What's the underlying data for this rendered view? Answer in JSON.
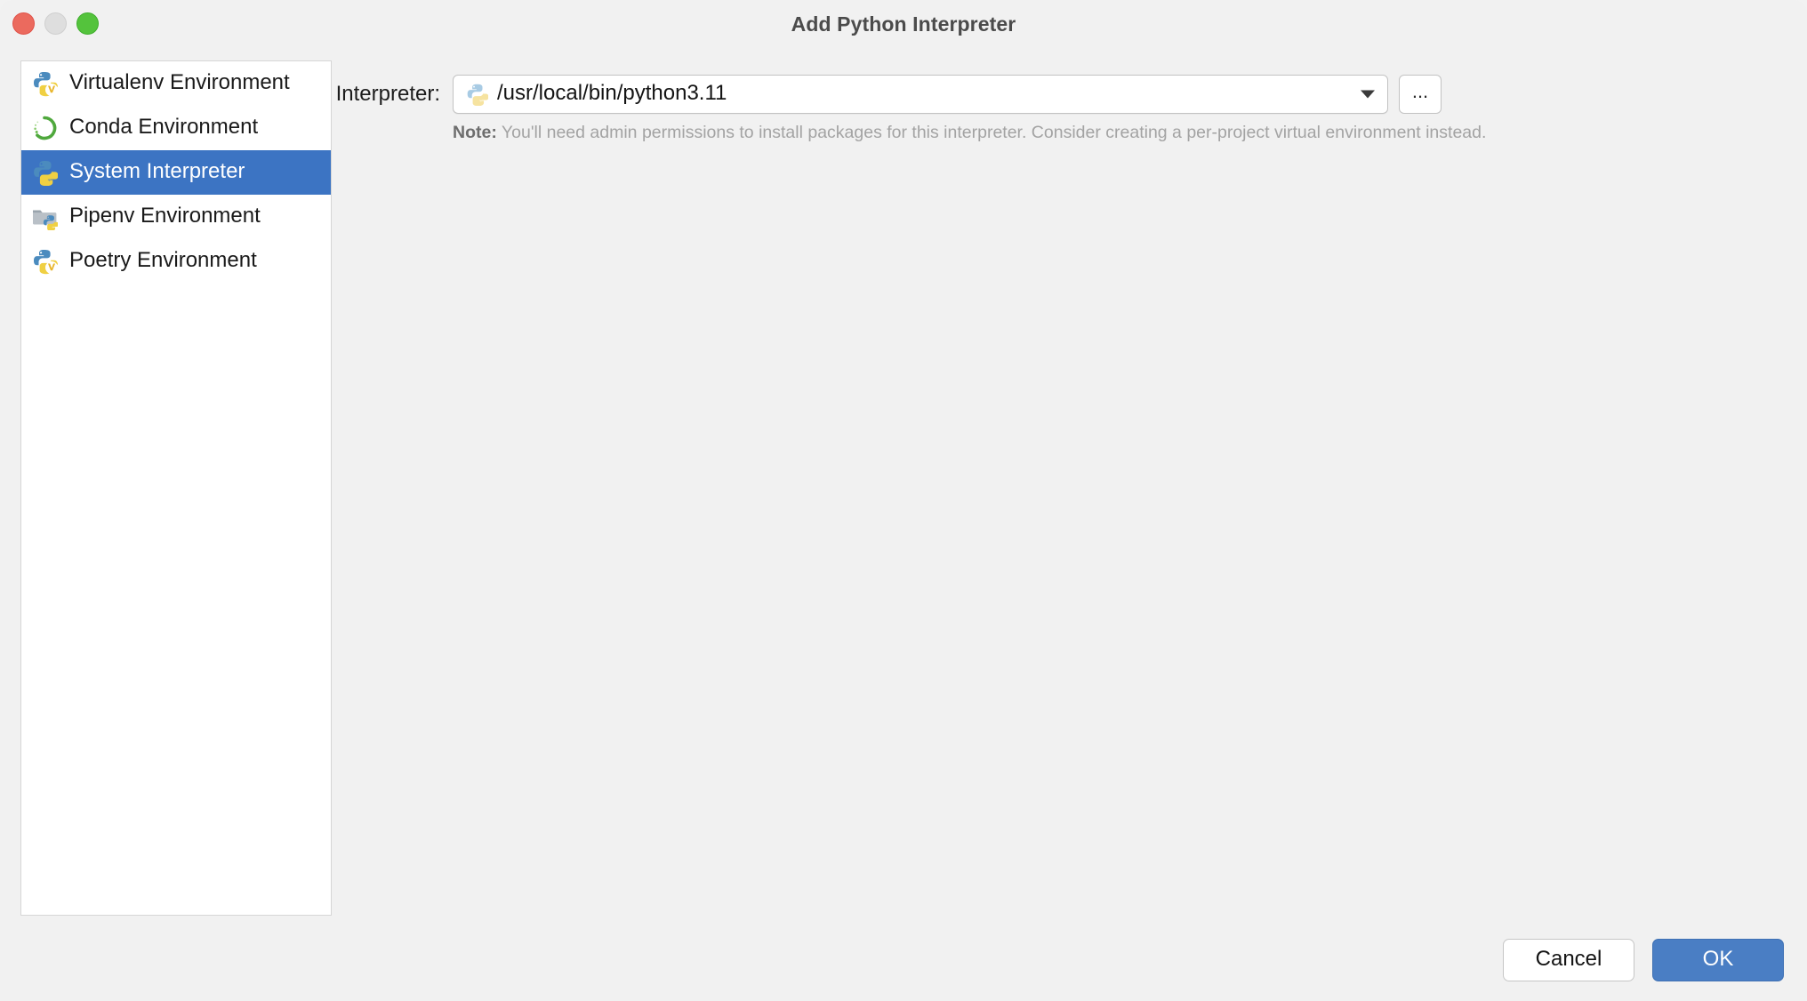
{
  "window": {
    "title": "Add Python Interpreter",
    "traffic_lights": {
      "close": "close-window",
      "minimize": "minimize-window",
      "zoom": "zoom-window",
      "close_color": "#eb6a5e",
      "minimize_color": "#dedede",
      "zoom_color": "#54c33c"
    }
  },
  "sidebar": {
    "items": [
      {
        "label": "Virtualenv Environment",
        "icon": "python-v-icon",
        "selected": false
      },
      {
        "label": "Conda Environment",
        "icon": "conda-circle-icon",
        "selected": false
      },
      {
        "label": "System Interpreter",
        "icon": "python-icon",
        "selected": true
      },
      {
        "label": "Pipenv Environment",
        "icon": "folder-python-icon",
        "selected": false
      },
      {
        "label": "Poetry Environment",
        "icon": "python-v-icon",
        "selected": false
      }
    ],
    "selection_color": "#3c74c3"
  },
  "main": {
    "interpreter": {
      "label": "Interpreter:",
      "value": "/usr/local/bin/python3.11",
      "icon": "python-pale-icon",
      "dropdown_icon": "chevron-down-icon",
      "browse_label": "...",
      "browse_name": "browse-button"
    },
    "note": {
      "prefix": "Note:",
      "text": "You'll need admin permissions to install packages for this interpreter. Consider creating a per-project virtual environment instead."
    }
  },
  "footer": {
    "cancel_label": "Cancel",
    "ok_label": "OK",
    "ok_color": "#4a7ec4"
  }
}
